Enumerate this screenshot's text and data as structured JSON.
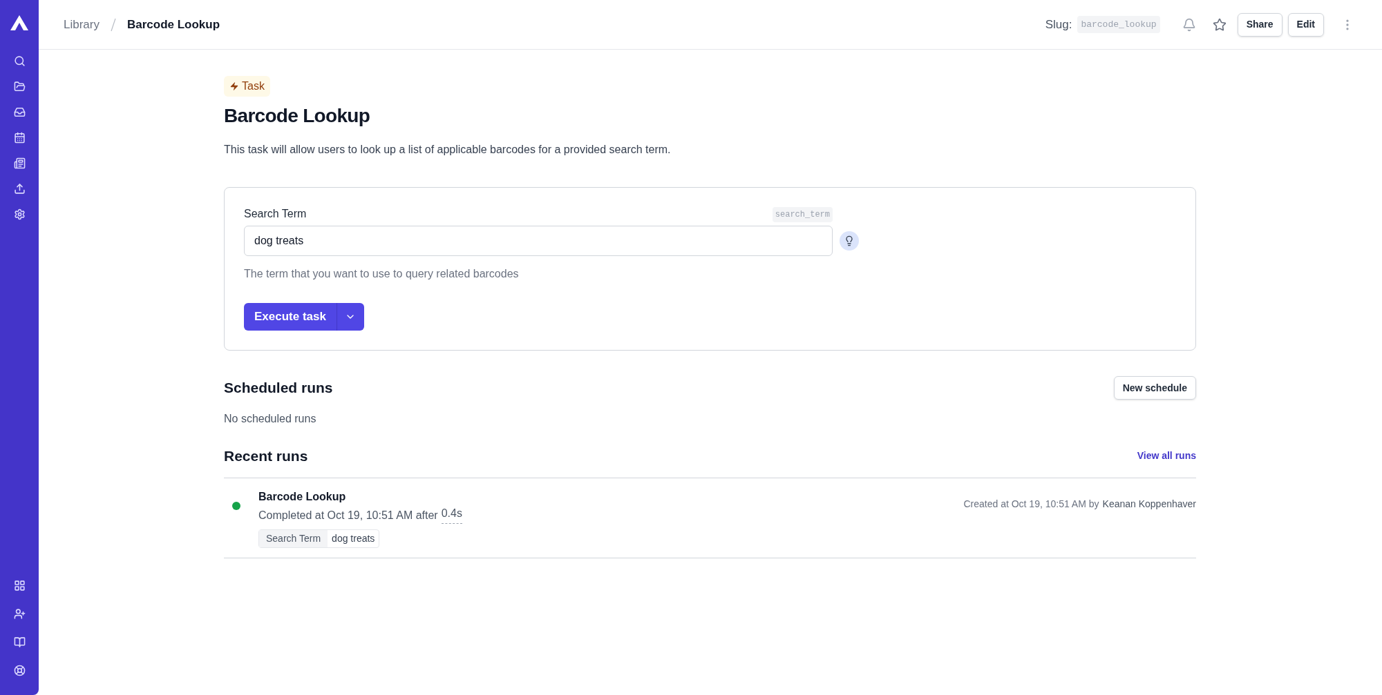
{
  "breadcrumb": [
    {
      "label": "Library",
      "current": false
    },
    {
      "label": "Barcode Lookup",
      "current": true
    }
  ],
  "header": {
    "slug_label": "Slug:",
    "slug": "barcode_lookup",
    "buttons": [
      "Share",
      "Edit"
    ]
  },
  "badge": "Task",
  "title": "Barcode Lookup",
  "description": "This task will allow users to look up a list of applicable barcodes for a provided search term.",
  "form": {
    "label": "Search Term",
    "key": "search_term",
    "value": "dog treats",
    "help": "The term that you want to use to query related barcodes",
    "submit": "Execute task"
  },
  "scheduled": {
    "title": "Scheduled runs",
    "button": "New schedule",
    "empty": "No scheduled runs"
  },
  "recent": {
    "title": "Recent runs",
    "link": "View all runs",
    "runs": [
      {
        "name": "Barcode Lookup",
        "color": "#16a34a",
        "summary": "Completed at Oct 19, 10:51 AM after",
        "duration": "0.4s",
        "param_label": "Search Term",
        "param_value": "dog treats",
        "created": "Created at Oct 19, 10:51 AM by",
        "creator": "Keanan Koppenhaver"
      }
    ]
  }
}
